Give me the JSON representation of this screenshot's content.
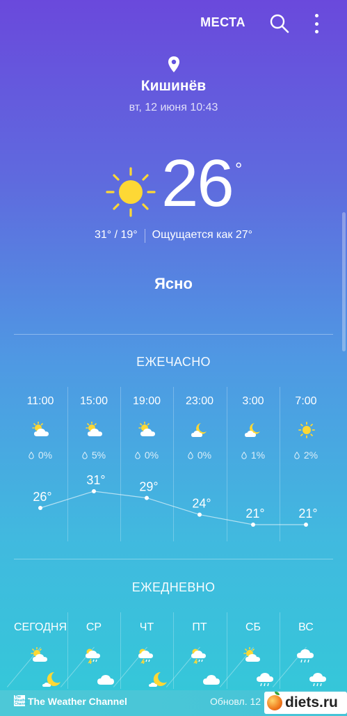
{
  "header": {
    "places_label": "МЕСТА",
    "search_icon": "search-icon",
    "more_icon": "more-vert-icon"
  },
  "location": {
    "city": "Кишинёв",
    "datetime": "вт, 12 июня 10:43"
  },
  "current": {
    "temp": "26",
    "degree": "°",
    "high_low": "31° / 19°",
    "feels_like": "Ощущается как 27°",
    "condition": "Ясно"
  },
  "hourly": {
    "title": "ЕЖЕЧАСНО",
    "items": [
      {
        "time": "11:00",
        "icon": "partly-cloudy-day-icon",
        "precip": "0%",
        "temp": "26°",
        "value": 26
      },
      {
        "time": "15:00",
        "icon": "partly-cloudy-day-icon",
        "precip": "5%",
        "temp": "31°",
        "value": 31
      },
      {
        "time": "19:00",
        "icon": "partly-cloudy-day-icon",
        "precip": "0%",
        "temp": "29°",
        "value": 29
      },
      {
        "time": "23:00",
        "icon": "moon-cloud-icon",
        "precip": "0%",
        "temp": "24°",
        "value": 24
      },
      {
        "time": "3:00",
        "icon": "moon-cloud-icon",
        "precip": "1%",
        "temp": "21°",
        "value": 21
      },
      {
        "time": "7:00",
        "icon": "sun-icon",
        "precip": "2%",
        "temp": "21°",
        "value": 21
      }
    ]
  },
  "daily": {
    "title": "ЕЖЕДНЕВНО",
    "items": [
      {
        "day": "СЕГОДНЯ",
        "day_icon": "partly-cloudy-day-icon",
        "night_icon": "moon-icon"
      },
      {
        "day": "СР",
        "day_icon": "thunder-rain-icon",
        "night_icon": "cloud-icon"
      },
      {
        "day": "ЧТ",
        "day_icon": "thunder-rain-icon",
        "night_icon": "moon-icon"
      },
      {
        "day": "ПТ",
        "day_icon": "thunder-rain-icon",
        "night_icon": "cloud-icon"
      },
      {
        "day": "СБ",
        "day_icon": "partly-cloudy-day-icon",
        "night_icon": "cloud-rain-icon"
      },
      {
        "day": "ВС",
        "day_icon": "cloud-rain-icon",
        "night_icon": "cloud-rain-icon"
      }
    ]
  },
  "footer": {
    "provider": "The Weather Channel",
    "updated": "Обновл. 12"
  },
  "watermark": {
    "text": "diets.ru"
  },
  "colors": {
    "sun": "#fdd835",
    "top_gradient": "#6a49dc",
    "bottom_gradient": "#33c9d8"
  }
}
